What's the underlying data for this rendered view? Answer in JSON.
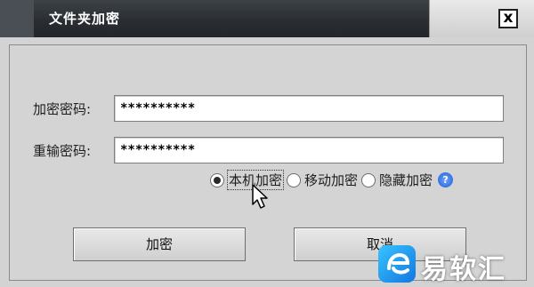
{
  "window": {
    "title": "文件夹加密",
    "close_label": "x"
  },
  "form": {
    "password_label": "加密密码:",
    "password_value": "**********",
    "confirm_label": "重输密码:",
    "confirm_value": "**********"
  },
  "encrypt_modes": [
    {
      "label": "本机加密",
      "selected": true
    },
    {
      "label": "移动加密",
      "selected": false
    },
    {
      "label": "隐藏加密",
      "selected": false
    }
  ],
  "help_icon": "question-mark",
  "buttons": {
    "encrypt_label": "加密",
    "cancel_label": "取消"
  },
  "watermark": {
    "text": "易软汇"
  },
  "colors": {
    "titlebar": "#2a2e33",
    "dialog_bg": "#d4d4d4",
    "help_blue": "#1e5fd6",
    "logo_blue": "#1e8cf0"
  }
}
